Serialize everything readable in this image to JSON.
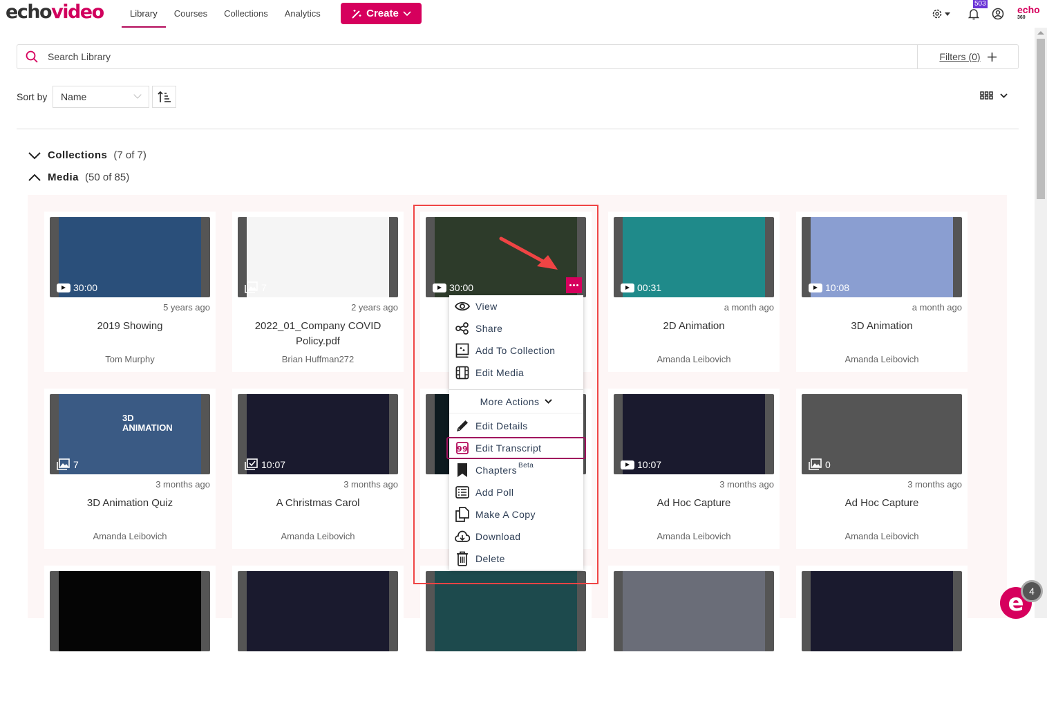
{
  "app": {
    "logo_part1": "echo",
    "logo_part2": "video"
  },
  "nav": {
    "items": [
      {
        "label": "Library",
        "active": true
      },
      {
        "label": "Courses"
      },
      {
        "label": "Collections"
      },
      {
        "label": "Analytics"
      }
    ],
    "create_label": "Create"
  },
  "header_right": {
    "notification_count": "503",
    "brand": "echo",
    "brand_sub": "360"
  },
  "search": {
    "placeholder": "Search Library",
    "filters_label": "Filters (0)"
  },
  "sort": {
    "label": "Sort by",
    "selected": "Name"
  },
  "sections": {
    "collections": {
      "label": "Collections",
      "count": "(7 of 7)",
      "expanded": false
    },
    "media": {
      "label": "Media",
      "count": "(50 of 85)",
      "expanded": true
    }
  },
  "media": [
    {
      "title": "2019 Showing",
      "date": "5 years ago",
      "owner": "Tom Murphy",
      "badge": "30:00",
      "type": "video",
      "thumb_color": "#2a4f7a"
    },
    {
      "title": "2022_01_Company COVID Policy.pdf",
      "date": "2 years ago",
      "owner": "Brian Huffman272",
      "badge": "7",
      "type": "slides",
      "thumb_color": "#f5f5f5"
    },
    {
      "title": "",
      "date": "",
      "owner": "",
      "badge": "30:00",
      "type": "video",
      "thumb_color": "#2d3b2a"
    },
    {
      "title": "2D Animation",
      "date": "a month ago",
      "owner": "Amanda Leibovich",
      "badge": "00:31",
      "type": "video",
      "thumb_color": "#1f8a8a"
    },
    {
      "title": "3D Animation",
      "date": "a month ago",
      "owner": "Amanda Leibovich",
      "badge": "10:08",
      "type": "video",
      "thumb_color": "#8a9ed1"
    },
    {
      "title": "3D Animation Quiz",
      "date": "3 months ago",
      "owner": "Amanda Leibovich",
      "badge": "7",
      "type": "slides",
      "thumb_color": "#3a5a84",
      "thumb_text": "3D ANIMATION"
    },
    {
      "title": "A Christmas Carol",
      "date": "3 months ago",
      "owner": "Amanda Leibovich",
      "badge": "10:07",
      "type": "quiz",
      "thumb_color": "#1a1a2e"
    },
    {
      "title": "",
      "date": "",
      "owner": "",
      "badge": "",
      "type": "video",
      "thumb_color": "#0d1a1f"
    },
    {
      "title": "Ad Hoc Capture",
      "date": "3 months ago",
      "owner": "Amanda Leibovich",
      "badge": "10:07",
      "type": "video",
      "thumb_color": "#1a1a2e"
    },
    {
      "title": "Ad Hoc Capture",
      "date": "3 months ago",
      "owner": "Amanda Leibovich",
      "badge": "0",
      "type": "slides",
      "thumb_color": "#555555"
    },
    {
      "type": "video",
      "thumb_color": "#050505"
    },
    {
      "type": "video",
      "thumb_color": "#1a1a2e"
    },
    {
      "type": "video",
      "thumb_color": "#1d4a4d"
    },
    {
      "type": "video",
      "thumb_color": "#6a6d78"
    },
    {
      "type": "video",
      "thumb_color": "#1a1a2e"
    }
  ],
  "context_menu": {
    "items": [
      "View",
      "Share",
      "Add To Collection",
      "Edit Media"
    ],
    "more_actions_label": "More Actions",
    "more_items": [
      "Edit Details",
      "Edit Transcript",
      "Chapters",
      "Add Poll",
      "Make A Copy",
      "Download",
      "Delete"
    ],
    "chapters_badge": "Beta",
    "selected": "Edit Transcript"
  },
  "fab": {
    "letter": "e",
    "count": "4"
  },
  "colors": {
    "brand": "#d6005d",
    "highlight": "#ef4444",
    "selected_outline": "#a0115e"
  }
}
